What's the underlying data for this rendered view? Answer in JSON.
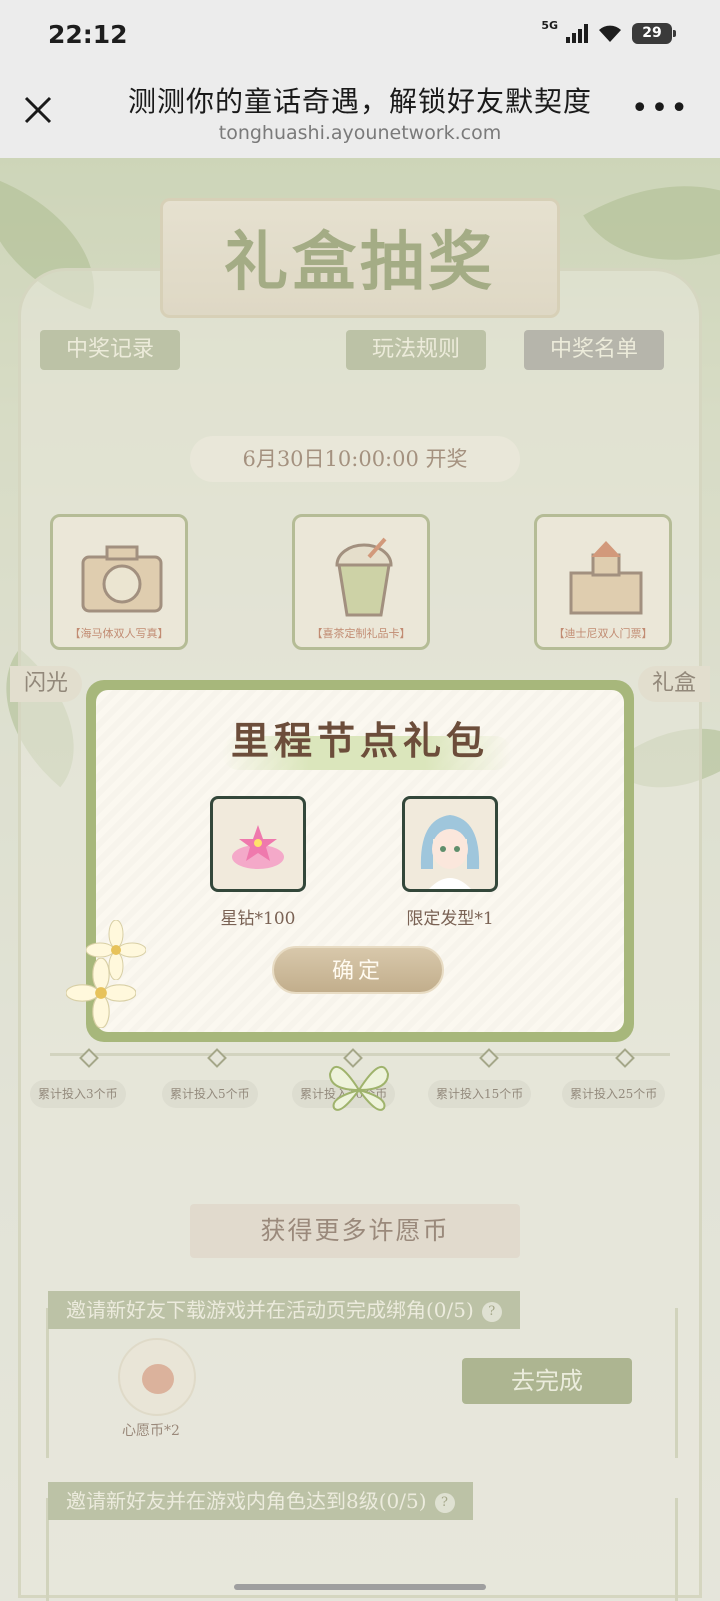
{
  "status_bar": {
    "time": "22:12",
    "network": "5G",
    "battery": "29"
  },
  "browser": {
    "title": "测测你的童话奇遇，解锁好友默契度",
    "url": "tonghuashi.ayounetwork.com",
    "more": "•••"
  },
  "page": {
    "banner_title": "礼盒抽奖",
    "tabs": [
      "中奖记录",
      "玩法规则",
      "中奖名单"
    ],
    "draw_time": "6月30日10:00:00 开奖",
    "prizes": [
      "【海马体双人写真】",
      "【喜茶定制礼品卡】",
      "【迪士尼双人门票】"
    ],
    "side_tab_left": "闪光",
    "side_tab_right": "礼盒",
    "milestones": [
      "累计投入3个币",
      "累计投入5个币",
      "累计投入10个币",
      "累计投入15个币",
      "累计投入25个币"
    ],
    "more_coins_title": "获得更多许愿币",
    "tasks": [
      {
        "title": "邀请新好友下载游戏并在活动页完成绑角(0/5)",
        "reward": "心愿币*2",
        "button": "去完成"
      },
      {
        "title": "邀请新好友并在游戏内角色达到8级(0/5)"
      }
    ],
    "help": "?"
  },
  "modal": {
    "title": "里程节点礼包",
    "items": [
      {
        "label": "星钻*100",
        "icon": "star-diamond-icon"
      },
      {
        "label": "限定发型*1",
        "icon": "hairstyle-avatar-icon"
      }
    ],
    "confirm": "确定"
  },
  "colors": {
    "accent_green": "#a7b77b",
    "title_brown": "#6c4d3a",
    "button_tan": "#c2ae8c"
  }
}
